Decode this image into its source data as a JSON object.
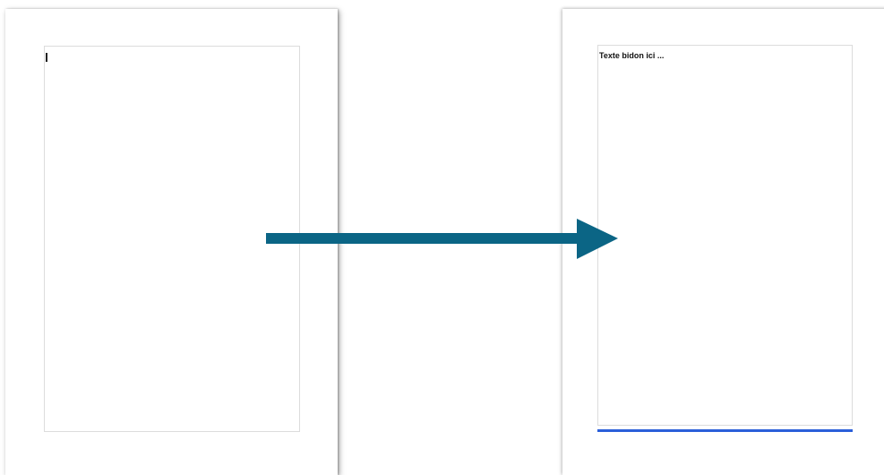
{
  "before_page": {
    "text": ""
  },
  "after_page": {
    "text": "Texte bidon ici ..."
  },
  "arrow": {
    "color": "#0b6585"
  },
  "colors": {
    "page_border": "#dcdcdc",
    "focus_underline": "#2b5fd9"
  }
}
